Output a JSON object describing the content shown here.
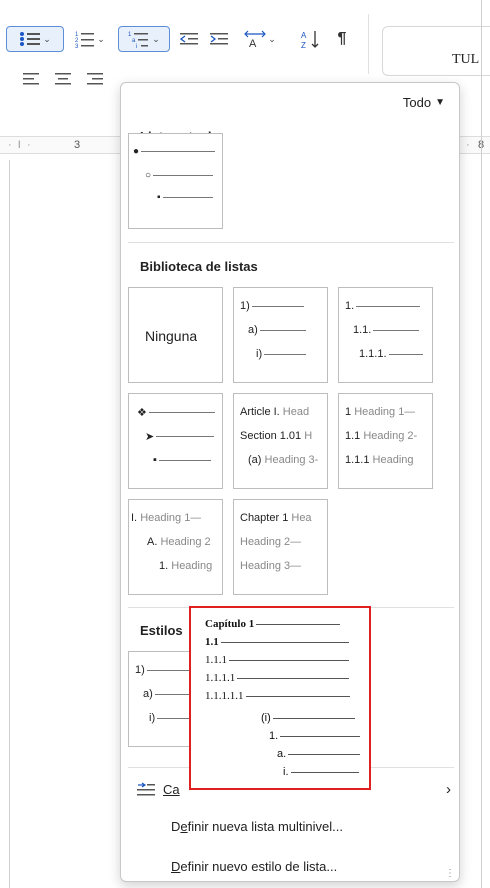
{
  "document": {
    "heading_fragment": "TUL"
  },
  "ruler": {
    "left_mark": "3",
    "right_mark": "8"
  },
  "panel": {
    "filter_label": "Todo",
    "current_section": "Lista actual",
    "library_section": "Biblioteca de listas",
    "styles_section": "Estilos",
    "library": {
      "none_label": "Ninguna",
      "tile2": [
        "1)",
        "a)",
        "i)"
      ],
      "tile3": [
        "1.",
        "1.1.",
        "1.1.1."
      ],
      "tile5": [
        [
          "Article I.",
          "Head"
        ],
        [
          "Section 1.01",
          "H"
        ],
        [
          "(a)",
          "Heading 3-"
        ]
      ],
      "tile6": [
        [
          "1",
          "Heading 1—"
        ],
        [
          "1.1",
          "Heading 2-"
        ],
        [
          "1.1.1",
          "Heading"
        ]
      ],
      "tile7": [
        [
          "I.",
          "Heading 1—"
        ],
        [
          "A.",
          "Heading 2"
        ],
        [
          "1.",
          "Heading"
        ]
      ],
      "tile8": [
        [
          "Chapter 1",
          "Hea"
        ],
        [
          "",
          "Heading 2—"
        ],
        [
          "",
          "Heading 3—"
        ]
      ]
    },
    "styles_tile": [
      "1)",
      "a)",
      "i)"
    ],
    "menu": {
      "change_level_prefix": "Ca",
      "define_multilevel_pre": "D",
      "define_multilevel_key": "e",
      "define_multilevel_post": "finir nueva lista multinivel...",
      "define_style_key": "D",
      "define_style_post": "efinir nuevo estilo de lista..."
    }
  },
  "preview": {
    "lines": [
      "Capítulo 1",
      "1.1",
      "1.1.1",
      "1.1.1.1",
      "1.1.1.1.1",
      "(i)",
      "1.",
      "a.",
      "i."
    ]
  }
}
